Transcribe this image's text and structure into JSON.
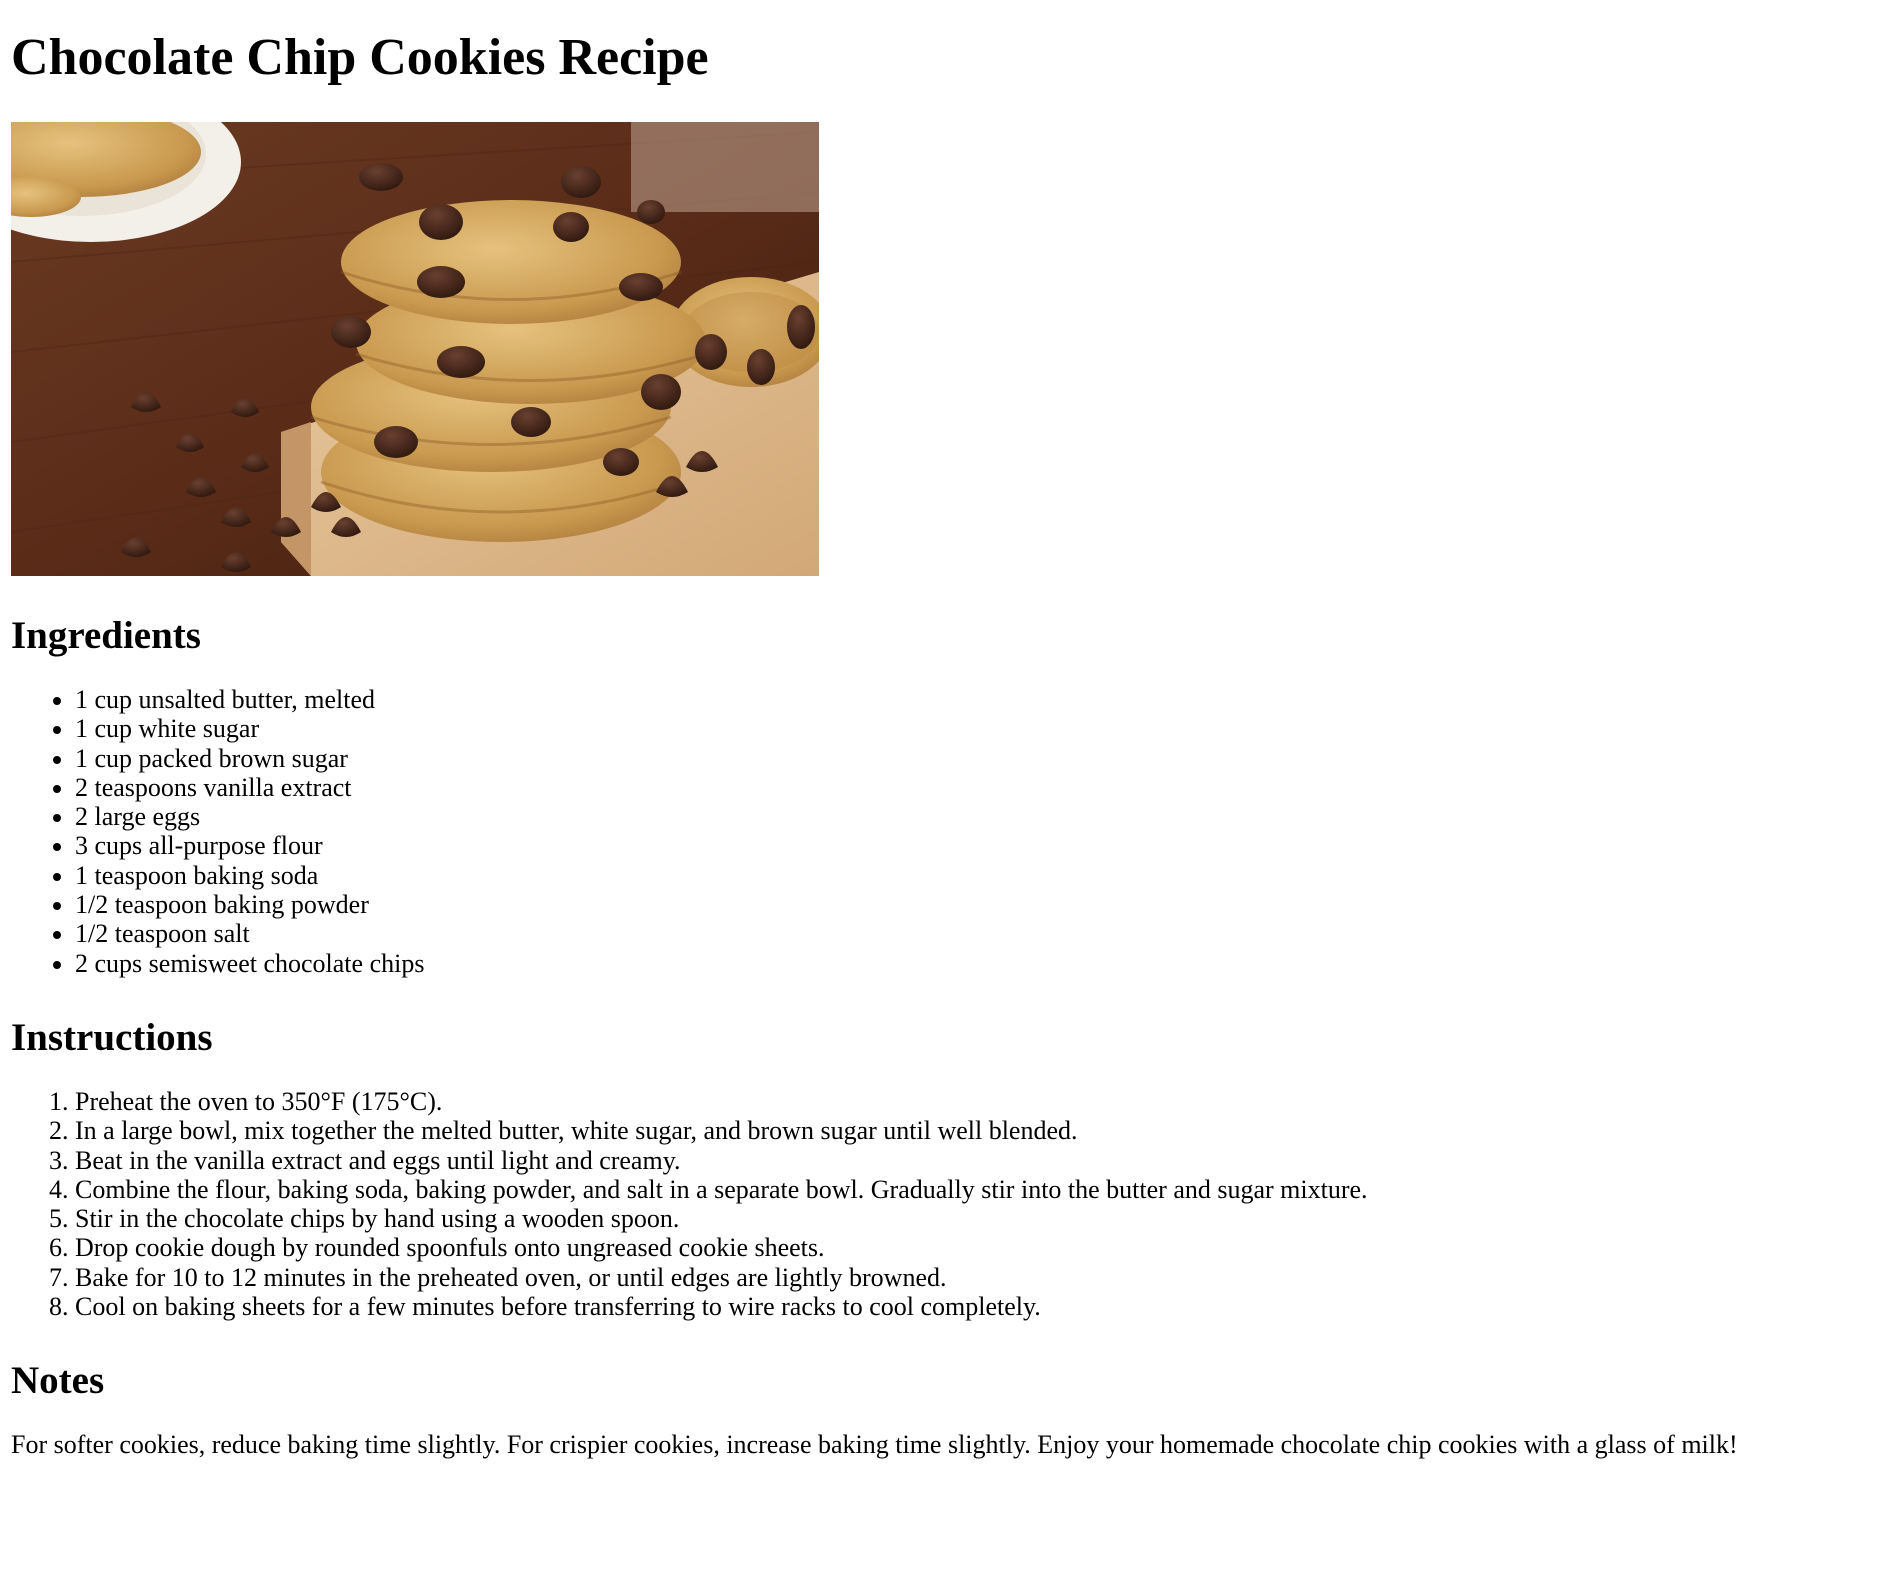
{
  "title": "Chocolate Chip Cookies Recipe",
  "image": {
    "alt": "Stack of chocolate chip cookies on a wooden cutting board"
  },
  "ingredients": {
    "heading": "Ingredients",
    "items": [
      "1 cup unsalted butter, melted",
      "1 cup white sugar",
      "1 cup packed brown sugar",
      "2 teaspoons vanilla extract",
      "2 large eggs",
      "3 cups all-purpose flour",
      "1 teaspoon baking soda",
      "1/2 teaspoon baking powder",
      "1/2 teaspoon salt",
      "2 cups semisweet chocolate chips"
    ]
  },
  "instructions": {
    "heading": "Instructions",
    "steps": [
      "Preheat the oven to 350°F (175°C).",
      "In a large bowl, mix together the melted butter, white sugar, and brown sugar until well blended.",
      "Beat in the vanilla extract and eggs until light and creamy.",
      "Combine the flour, baking soda, baking powder, and salt in a separate bowl. Gradually stir into the butter and sugar mixture.",
      "Stir in the chocolate chips by hand using a wooden spoon.",
      "Drop cookie dough by rounded spoonfuls onto ungreased cookie sheets.",
      "Bake for 10 to 12 minutes in the preheated oven, or until edges are lightly browned.",
      "Cool on baking sheets for a few minutes before transferring to wire racks to cool completely."
    ]
  },
  "notes": {
    "heading": "Notes",
    "text": "For softer cookies, reduce baking time slightly. For crispier cookies, increase baking time slightly. Enjoy your homemade chocolate chip cookies with a glass of milk!"
  }
}
